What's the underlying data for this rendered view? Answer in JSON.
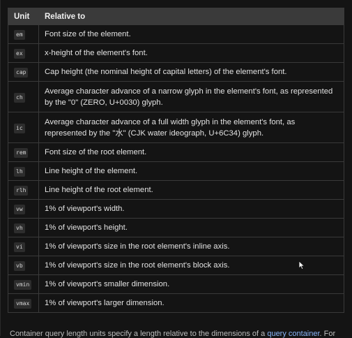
{
  "table": {
    "headers": {
      "unit": "Unit",
      "relative_to": "Relative to"
    },
    "rows": [
      {
        "unit": "em",
        "relative_to": "Font size of the element."
      },
      {
        "unit": "ex",
        "relative_to": "x-height of the element's font."
      },
      {
        "unit": "cap",
        "relative_to": "Cap height (the nominal height of capital letters) of the element's font."
      },
      {
        "unit": "ch",
        "relative_to": "Average character advance of a narrow glyph in the element's font, as represented by the \"0\" (ZERO, U+0030) glyph."
      },
      {
        "unit": "ic",
        "relative_to": "Average character advance of a full width glyph in the element's font, as represented by the \"水\" (CJK water ideograph, U+6C34) glyph."
      },
      {
        "unit": "rem",
        "relative_to": "Font size of the root element."
      },
      {
        "unit": "lh",
        "relative_to": "Line height of the element."
      },
      {
        "unit": "rlh",
        "relative_to": "Line height of the root element."
      },
      {
        "unit": "vw",
        "relative_to": "1% of viewport's width."
      },
      {
        "unit": "vh",
        "relative_to": "1% of viewport's height."
      },
      {
        "unit": "vi",
        "relative_to": "1% of viewport's size in the root element's inline axis."
      },
      {
        "unit": "vb",
        "relative_to": "1% of viewport's size in the root element's block axis."
      },
      {
        "unit": "vmin",
        "relative_to": "1% of viewport's smaller dimension."
      },
      {
        "unit": "vmax",
        "relative_to": "1% of viewport's larger dimension."
      }
    ]
  },
  "bottom_text": {
    "before": "Container query length units specify a length relative to the dimensions of a ",
    "link": "query container",
    "after": ". For"
  },
  "colors": {
    "background": "#141414",
    "header_background": "#3a3a3a",
    "border": "#3a3a3a",
    "code_background": "#2d2d2d",
    "link": "#8ab4f8"
  }
}
